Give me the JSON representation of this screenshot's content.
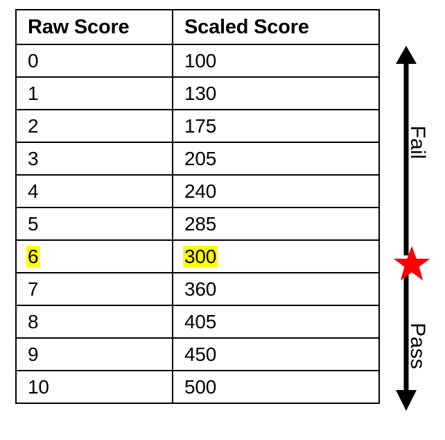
{
  "table": {
    "columns": [
      "Raw Score",
      "Scaled Score"
    ],
    "rows": [
      {
        "raw": "0",
        "scaled": "100",
        "highlight": false
      },
      {
        "raw": "1",
        "scaled": "130",
        "highlight": false
      },
      {
        "raw": "2",
        "scaled": "175",
        "highlight": false
      },
      {
        "raw": "3",
        "scaled": "205",
        "highlight": false
      },
      {
        "raw": "4",
        "scaled": "240",
        "highlight": false
      },
      {
        "raw": "5",
        "scaled": "285",
        "highlight": false
      },
      {
        "raw": "6",
        "scaled": "300",
        "highlight": true
      },
      {
        "raw": "7",
        "scaled": "360",
        "highlight": false
      },
      {
        "raw": "8",
        "scaled": "405",
        "highlight": false
      },
      {
        "raw": "9",
        "scaled": "450",
        "highlight": false
      },
      {
        "raw": "10",
        "scaled": "500",
        "highlight": false
      }
    ],
    "highlight_color": "#FFFF00"
  },
  "annotations": {
    "fail_label": "Fail",
    "pass_label": "Pass",
    "cut_score_marker": "star",
    "marker_color": "#FF0000",
    "arrow_color": "#000000"
  },
  "chart_data": {
    "type": "table",
    "title": "",
    "categories": [
      "Raw Score",
      "Scaled Score"
    ],
    "x": [
      0,
      1,
      2,
      3,
      4,
      5,
      6,
      7,
      8,
      9,
      10
    ],
    "series": [
      {
        "name": "Scaled Score",
        "values": [
          100,
          130,
          175,
          205,
          240,
          285,
          300,
          360,
          405,
          450,
          500
        ]
      }
    ],
    "annotations": [
      {
        "label": "Fail",
        "range_raw": [
          0,
          5
        ],
        "range_scaled": [
          100,
          285
        ],
        "direction": "up"
      },
      {
        "label": "Pass",
        "range_raw": [
          7,
          10
        ],
        "range_scaled": [
          360,
          500
        ],
        "direction": "down"
      },
      {
        "label": "cut score",
        "raw": 6,
        "scaled": 300,
        "marker": "red-star",
        "highlighted": true
      }
    ],
    "xlabel": "Raw Score",
    "ylabel": "Scaled Score",
    "ylim": [
      100,
      500
    ]
  }
}
